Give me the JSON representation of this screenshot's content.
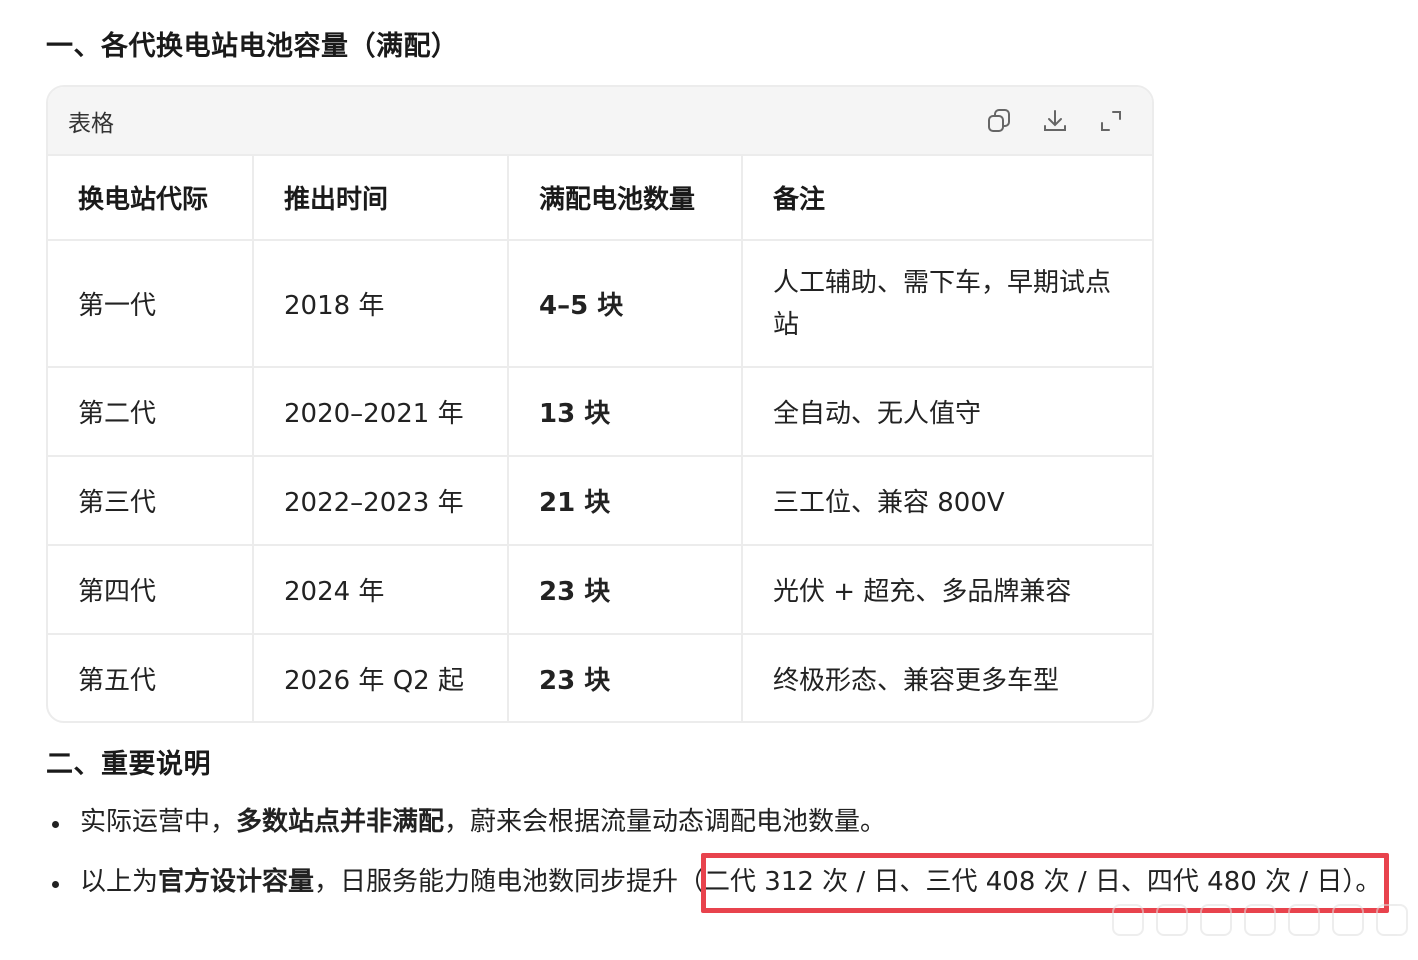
{
  "sections": {
    "h1": "一、各代换电站电池容量（满配）",
    "h2": "二、重要说明"
  },
  "table_card": {
    "label": "表格",
    "tools": [
      "copy-icon",
      "download-icon",
      "expand-icon"
    ]
  },
  "table": {
    "headers": [
      "换电站代际",
      "推出时间",
      "满配电池数量",
      "备注"
    ],
    "rows": [
      {
        "gen": "第一代",
        "time": "2018 年",
        "count": "4–5 块",
        "note": "人工辅助、需下车，早期试点站"
      },
      {
        "gen": "第二代",
        "time": "2020–2021 年",
        "count": "13 块",
        "note": "全自动、无人值守"
      },
      {
        "gen": "第三代",
        "time": "2022–2023 年",
        "count": "21 块",
        "note": "三工位、兼容 800V"
      },
      {
        "gen": "第四代",
        "time": "2024 年",
        "count": "23 块",
        "note": "光伏 + 超充、多品牌兼容"
      },
      {
        "gen": "第五代",
        "time": "2026 年 Q2 起",
        "count": "23 块",
        "note": "终极形态、兼容更多车型"
      }
    ]
  },
  "bullets": [
    {
      "pre": "实际运营中，",
      "bold": "多数站点并非满配",
      "post": "，蔚来会根据流量动态调配电池数量。"
    },
    {
      "pre": "以上为",
      "bold": "官方设计容量",
      "post": "，日服务能力随电池数同步提升（二代 312 次 / 日、三代 408 次 / 日、四代 480 次 / 日）。"
    }
  ],
  "colors": {
    "highlight": "#e8434d",
    "border": "#ececec",
    "header_bg": "#f5f5f5"
  }
}
